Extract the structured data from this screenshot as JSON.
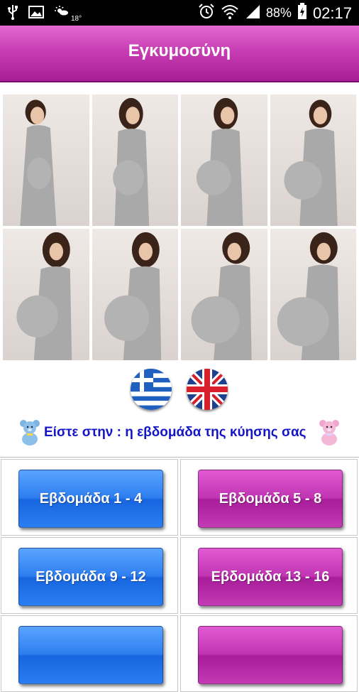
{
  "status_bar": {
    "temperature": "18°",
    "battery": "88%",
    "time": "02:17"
  },
  "header": {
    "title": "Εγκυμοσύνη"
  },
  "languages": [
    {
      "name": "greek-flag-icon"
    },
    {
      "name": "uk-flag-icon"
    }
  ],
  "greeting": {
    "text": "Είστε στην :  η εβδομάδα της κύησης σας"
  },
  "week_buttons": [
    {
      "label": "Εβδομάδα 1 - 4",
      "color": "#2e7ef0"
    },
    {
      "label": "Εβδομάδα 5 - 8",
      "color": "#c135b3"
    },
    {
      "label": "Εβδομάδα 9 - 12",
      "color": "#2e7ef0"
    },
    {
      "label": "Εβδομάδα 13 - 16",
      "color": "#c135b3"
    },
    {
      "label": "",
      "color": "#2e7ef0"
    },
    {
      "label": "",
      "color": "#c135b3"
    }
  ],
  "colors": {
    "header_pink": "#c83db4",
    "greeting_blue": "#1515c8",
    "button_blue": "#2e7ef0",
    "button_pink": "#c135b3"
  }
}
